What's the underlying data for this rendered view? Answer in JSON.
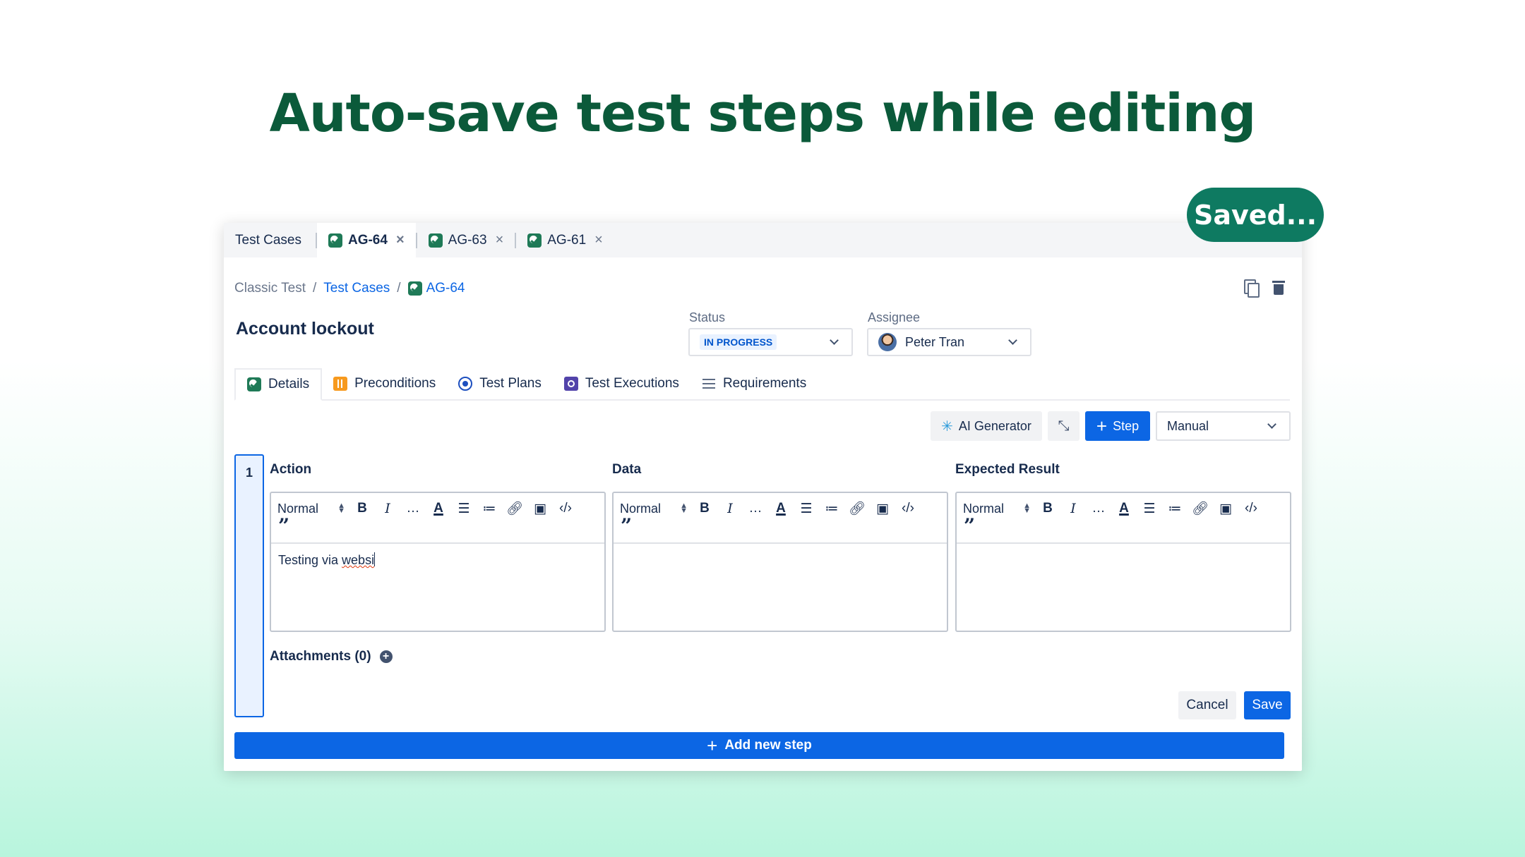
{
  "hero": {
    "title": "Auto-save test steps while editing"
  },
  "saved_pill": "Saved...",
  "window_tabs": [
    {
      "label": "Test Cases",
      "closable": false
    },
    {
      "label": "AG-64",
      "closable": true,
      "active": true
    },
    {
      "label": "AG-63",
      "closable": true
    },
    {
      "label": "AG-61",
      "closable": true
    }
  ],
  "close_glyph": "×",
  "breadcrumb": {
    "root": "Classic Test",
    "parent": "Test Cases",
    "current": "AG-64"
  },
  "page_title": "Account lockout",
  "status": {
    "label": "Status",
    "value": "IN PROGRESS"
  },
  "assignee": {
    "label": "Assignee",
    "value": "Peter Tran"
  },
  "sub_tabs": [
    "Details",
    "Preconditions",
    "Test Plans",
    "Test Executions",
    "Requirements"
  ],
  "toolbar": {
    "ai_generator": "AI Generator",
    "step_button": "Step",
    "mode": "Manual"
  },
  "step": {
    "number": "1",
    "columns": [
      "Action",
      "Data",
      "Expected Result"
    ],
    "format": "Normal",
    "action_text_plain": "Testing via ",
    "action_text_misspelled": "websi",
    "data_text": "",
    "expected_text": ""
  },
  "attachments_label": "Attachments (0)",
  "buttons": {
    "cancel": "Cancel",
    "save": "Save",
    "add_new_step": "Add new step"
  },
  "colors": {
    "accent": "#0c66e4",
    "hero": "#0b5a3a",
    "pill": "#0e7a61"
  }
}
